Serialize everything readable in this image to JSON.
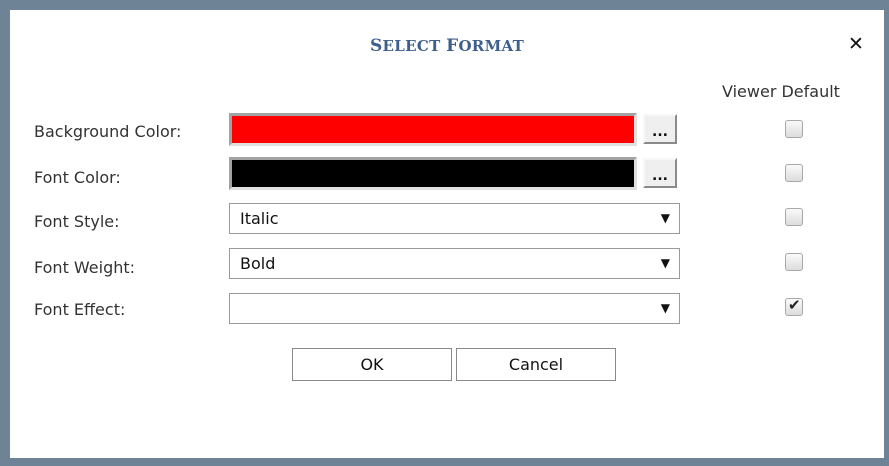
{
  "dialog": {
    "title_first_cap": "S",
    "title_first_rest": "ELECT",
    "title_second_cap": "F",
    "title_second_rest": "ORMAT",
    "close_symbol": "✕",
    "viewer_default_header": "Viewer Default"
  },
  "rows": [
    {
      "label": "Background Color:",
      "kind": "color",
      "color": "#ff0000",
      "picker_label": "...",
      "viewer_default": false
    },
    {
      "label": "Font Color:",
      "kind": "color",
      "color": "#000000",
      "picker_label": "...",
      "viewer_default": false
    },
    {
      "label": "Font Style:",
      "kind": "select",
      "value": "Italic",
      "viewer_default": false
    },
    {
      "label": "Font Weight:",
      "kind": "select",
      "value": "Bold",
      "viewer_default": false
    },
    {
      "label": "Font Effect:",
      "kind": "select",
      "value": "",
      "viewer_default": true
    }
  ],
  "dropdown_arrow": "▼",
  "checkmark": "✔",
  "buttons": {
    "ok": "OK",
    "cancel": "Cancel"
  }
}
